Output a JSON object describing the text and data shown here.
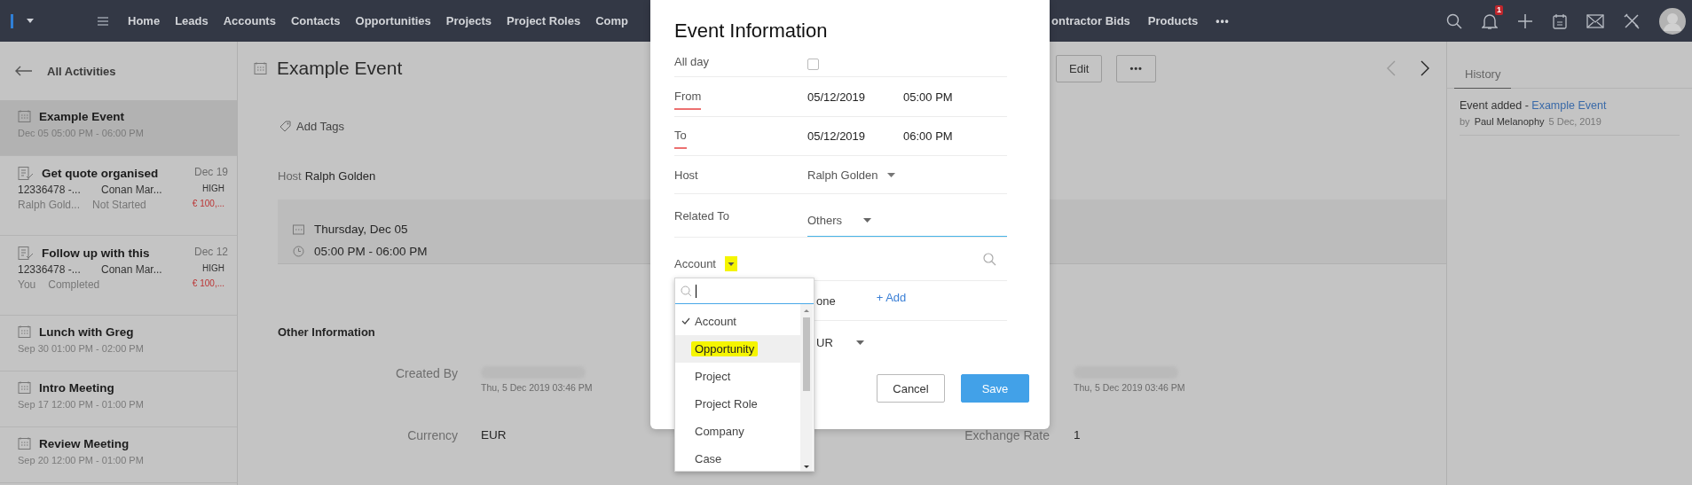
{
  "top_bar": {
    "nav_items": [
      {
        "label": "Home"
      },
      {
        "label": "Leads"
      },
      {
        "label": "Accounts"
      },
      {
        "label": "Contacts"
      },
      {
        "label": "Opportunities"
      },
      {
        "label": "Projects"
      },
      {
        "label": "Project Roles"
      },
      {
        "label": "Comp"
      }
    ],
    "nav_items_right": [
      {
        "label": "ontractor Bids"
      },
      {
        "label": "Products"
      }
    ],
    "more": "•••",
    "notification_count": "1"
  },
  "sidebar": {
    "back_label": "All Activities",
    "items": [
      {
        "kind": "event",
        "title": "Example Event",
        "time": "Dec 05 05:00 PM - 06:00 PM",
        "selected": true
      },
      {
        "kind": "task",
        "title": "Get quote organised",
        "due": "Dec 19",
        "related": "12336478 -...",
        "contact": "Conan Mar...",
        "priority": "HIGH",
        "owner": "Ralph Gold...",
        "status": "Not Started",
        "amount": "€ 100,...",
        "selected": false
      },
      {
        "kind": "task",
        "title": "Follow up with this",
        "due": "Dec 12",
        "related": "12336478 -...",
        "contact": "Conan Mar...",
        "priority": "HIGH",
        "owner": "You",
        "status": "Completed",
        "amount": "€ 100,...",
        "selected": false
      },
      {
        "kind": "event",
        "title": "Lunch with Greg",
        "time": "Sep 30 01:00 PM - 02:00 PM",
        "selected": false
      },
      {
        "kind": "event",
        "title": "Intro Meeting",
        "time": "Sep 17 12:00 PM - 01:00 PM",
        "selected": false
      },
      {
        "kind": "event",
        "title": "Review Meeting",
        "time": "Sep 20 12:00 PM - 01:00 PM",
        "selected": false
      }
    ]
  },
  "record": {
    "title": "Example Event",
    "edit": "Edit",
    "more": "•••",
    "add_tags": "Add Tags",
    "host_label": "Host",
    "host": "Ralph Golden",
    "date": "Thursday, Dec 05",
    "time": "05:00 PM - 06:00 PM",
    "section_title": "Other Information",
    "created_by": {
      "label": "Created By",
      "date": "Thu, 5 Dec 2019 03:46 PM"
    },
    "modified": {
      "date": "Thu, 5 Dec 2019 03:46 PM"
    },
    "currency": {
      "label": "Currency",
      "value": "EUR"
    },
    "exchange_rate": {
      "label": "Exchange Rate",
      "value": "1"
    }
  },
  "history": {
    "tab": "History",
    "entries": [
      {
        "action": "Event added -",
        "link": "Example Event",
        "by": "by",
        "user": "Paul Melanophy",
        "date": "5 Dec, 2019"
      }
    ]
  },
  "modal": {
    "title": "Event Information",
    "all_day": {
      "label": "All day",
      "checked": false
    },
    "from": {
      "label": "From",
      "required": true,
      "date": "05/12/2019",
      "time": "05:00 PM"
    },
    "to": {
      "label": "To",
      "required": true,
      "date": "05/12/2019",
      "time": "06:00 PM"
    },
    "host": {
      "label": "Host",
      "value": "Ralph Golden"
    },
    "related_to": {
      "label": "Related To",
      "value": "Others",
      "focused": true
    },
    "lookup": {
      "label": "Account",
      "caret_highlighted": true
    },
    "partial_row": {
      "value": "one",
      "add": "+ Add"
    },
    "partial_currency": {
      "value": "UR"
    },
    "buttons": [
      {
        "label": "Cancel",
        "kind": "secondary"
      },
      {
        "label": "Save",
        "kind": "primary"
      }
    ]
  },
  "dropdown": {
    "options": [
      {
        "label": "Account",
        "checked": true,
        "selected": false,
        "highlighted": false
      },
      {
        "label": "Opportunity",
        "checked": false,
        "selected": true,
        "highlighted": true
      },
      {
        "label": "Project",
        "checked": false,
        "selected": false,
        "highlighted": false
      },
      {
        "label": "Project Role",
        "checked": false,
        "selected": false,
        "highlighted": false
      },
      {
        "label": "Company",
        "checked": false,
        "selected": false,
        "highlighted": false
      },
      {
        "label": "Case",
        "checked": false,
        "selected": false,
        "highlighted": false
      }
    ]
  }
}
